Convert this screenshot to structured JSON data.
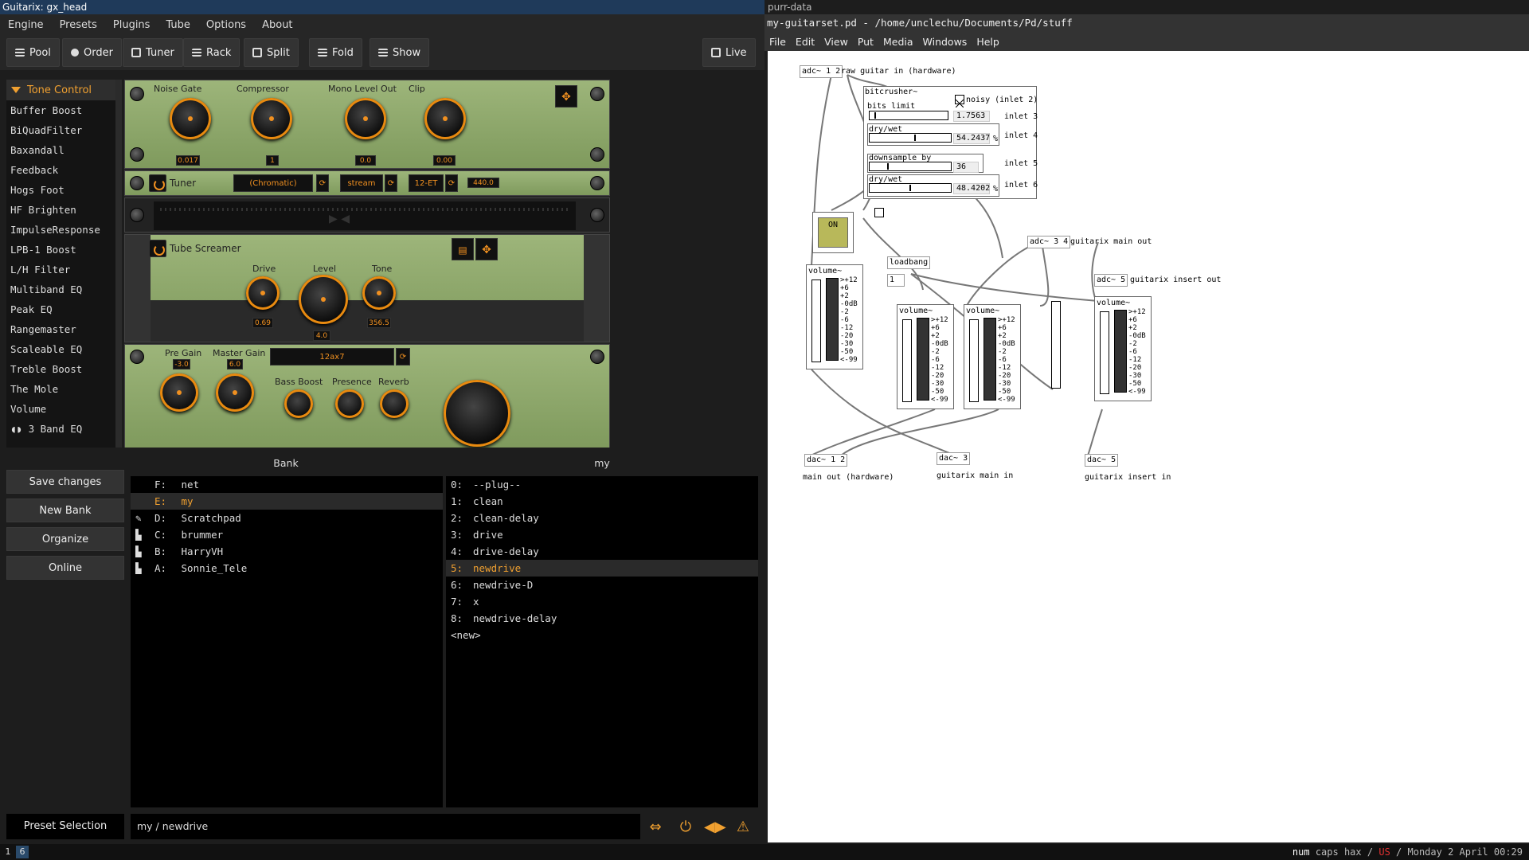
{
  "guitarix": {
    "title": "Guitarix: gx_head",
    "menu": [
      "Engine",
      "Presets",
      "Plugins",
      "Tube",
      "Options",
      "About"
    ],
    "toolbar": {
      "pool": "Pool",
      "order": "Order",
      "tuner": "Tuner",
      "rack": "Rack",
      "split": "Split",
      "fold": "Fold",
      "show": "Show",
      "live": "Live"
    },
    "sidebar": {
      "header": "Tone Control",
      "items": [
        "Buffer Boost",
        "BiQuadFilter",
        "Baxandall",
        "Feedback",
        "Hogs Foot",
        "HF Brighten",
        "ImpulseResponse",
        "LPB-1 Boost",
        "L/H Filter",
        "Multiband EQ",
        "Peak EQ",
        "Rangemaster",
        "Scaleable EQ",
        "Treble Boost",
        "The Mole",
        "Volume",
        "3 Band EQ"
      ]
    },
    "rack": {
      "unit1": {
        "noise_gate": "Noise Gate",
        "noise_gate_val": "0.017",
        "compressor": "Compressor",
        "compressor_val": "1",
        "mono_level": "Mono Level Out",
        "mono_level_val": "0.0",
        "clip": "Clip",
        "clip_val": "0.00"
      },
      "tuner": {
        "label": "Tuner",
        "mode": "(Chromatic)",
        "stream": "stream",
        "temperament": "12-ET",
        "freq": "440.0"
      },
      "tubescreamer": {
        "label": "Tube Screamer",
        "drive": "Drive",
        "drive_val": "0.69",
        "level": "Level",
        "level_val": "4.0",
        "tone": "Tone",
        "tone_val": "356.5"
      },
      "amp": {
        "pre_gain": "Pre Gain",
        "pre_gain_val": "-3.0",
        "master_gain": "Master Gain",
        "master_gain_val": "6.0",
        "tube": "12ax7",
        "bass_boost": "Bass Boost",
        "presence": "Presence",
        "reverb": "Reverb"
      }
    },
    "bank_buttons": [
      "Save changes",
      "New Bank",
      "Organize",
      "Online"
    ],
    "bank_header": "Bank",
    "banks": [
      {
        "key": "F:",
        "name": "net",
        "icon": "",
        "selected": false
      },
      {
        "key": "E:",
        "name": "my",
        "icon": "",
        "selected": true
      },
      {
        "key": "D:",
        "name": "Scratchpad",
        "icon": "pencil-icon",
        "selected": false
      },
      {
        "key": "C:",
        "name": "brummer",
        "icon": "factory-icon",
        "selected": false
      },
      {
        "key": "B:",
        "name": "HarryVH",
        "icon": "factory-icon",
        "selected": false
      },
      {
        "key": "A:",
        "name": "Sonnie_Tele",
        "icon": "factory-icon",
        "selected": false
      }
    ],
    "presets_header": "my",
    "presets": [
      {
        "key": "0:",
        "name": "--plug--",
        "selected": false
      },
      {
        "key": "1:",
        "name": "clean",
        "selected": false
      },
      {
        "key": "2:",
        "name": "clean-delay",
        "selected": false
      },
      {
        "key": "3:",
        "name": "drive",
        "selected": false
      },
      {
        "key": "4:",
        "name": "drive-delay",
        "selected": false
      },
      {
        "key": "5:",
        "name": "newdrive",
        "selected": true
      },
      {
        "key": "6:",
        "name": "newdrive-D",
        "selected": false
      },
      {
        "key": "7:",
        "name": "x",
        "selected": false
      },
      {
        "key": "8:",
        "name": "newdrive-delay",
        "selected": false
      }
    ],
    "presets_new": "<new>",
    "status": {
      "preset_selection": "Preset Selection",
      "current": "my / newdrive"
    }
  },
  "purrdata": {
    "topbar": "purr-data",
    "title": "my-guitarset.pd  - /home/unclechu/Documents/Pd/stuff",
    "menu": [
      "File",
      "Edit",
      "View",
      "Put",
      "Media",
      "Windows",
      "Help"
    ],
    "objects": {
      "adc12": "adc~ 1 2",
      "adc12_comment": "raw guitar in (hardware)",
      "bitcrusher": "bitcrusher~",
      "noisy": "noisy (inlet 2)",
      "bits_limit": "bits limit",
      "bits_limit_val": "1.7563",
      "inlet3": "inlet 3",
      "drywet1": "dry/wet",
      "drywet1_val": "54.2437",
      "pct1": "%",
      "inlet4": "inlet 4",
      "downsample": "downsample by",
      "downsample_val": "36",
      "inlet5": "inlet 5",
      "drywet2": "dry/wet",
      "drywet2_val": "48.4202",
      "pct2": "%",
      "inlet6": "inlet 6",
      "on": "ON",
      "adc34": "adc~ 3 4",
      "adc34_comment": "guitarix main out",
      "loadbang": "loadbang",
      "loadbang_num": "1",
      "adc5": "adc~ 5",
      "adc5_comment": "guitarix insert out",
      "volume": "volume~",
      "dac12": "dac~ 1 2",
      "dac12_comment": "main out (hardware)",
      "dac3": "dac~ 3",
      "dac3_comment": "guitarix main in",
      "dac5": "dac~ 5",
      "dac5_comment": "guitarix insert in"
    },
    "meter_scale": [
      ">+12",
      "+6",
      "+2",
      "-0dB",
      "-2",
      "-6",
      "-12",
      "-20",
      "-30",
      "-50",
      "<-99"
    ]
  },
  "taskbar": {
    "ws1": "1",
    "ws6": "6",
    "num": "num",
    "caps": "caps",
    "hax": "hax",
    "sep": "/",
    "lang": "US",
    "datetime": "Monday 2 April 00:29"
  }
}
